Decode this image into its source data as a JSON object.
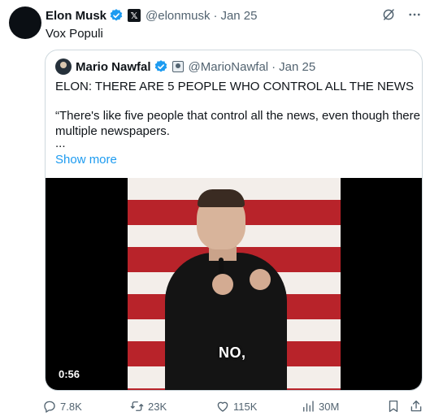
{
  "tweet": {
    "author_name": "Elon Musk",
    "handle": "@elonmusk",
    "separator": "·",
    "date": "Jan 25",
    "text": "Vox Populi"
  },
  "quote": {
    "author_name": "Mario Nawfal",
    "handle": "@MarioNawfal",
    "separator": "·",
    "date": "Jan 25",
    "line1": "ELON: THERE ARE 5 PEOPLE WHO CONTROL ALL THE NEWS",
    "line2": "“There's like five people that control all the news, even though there are",
    "line3": "multiple newspapers.",
    "line4": "...",
    "show_more": "Show more",
    "video": {
      "caption": "NO,",
      "duration": "0:56"
    }
  },
  "actions": {
    "replies": "7.8K",
    "reposts": "23K",
    "likes": "115K",
    "views": "30M"
  },
  "colors": {
    "accent": "#1d9bf0",
    "text": "#0f1419",
    "muted": "#536471",
    "border": "#cfd9de"
  },
  "icons": [
    "verified-badge-icon",
    "x-logo-icon",
    "grok-icon",
    "more-icon",
    "reply-icon",
    "repost-icon",
    "like-icon",
    "views-icon",
    "bookmark-icon",
    "share-icon"
  ]
}
